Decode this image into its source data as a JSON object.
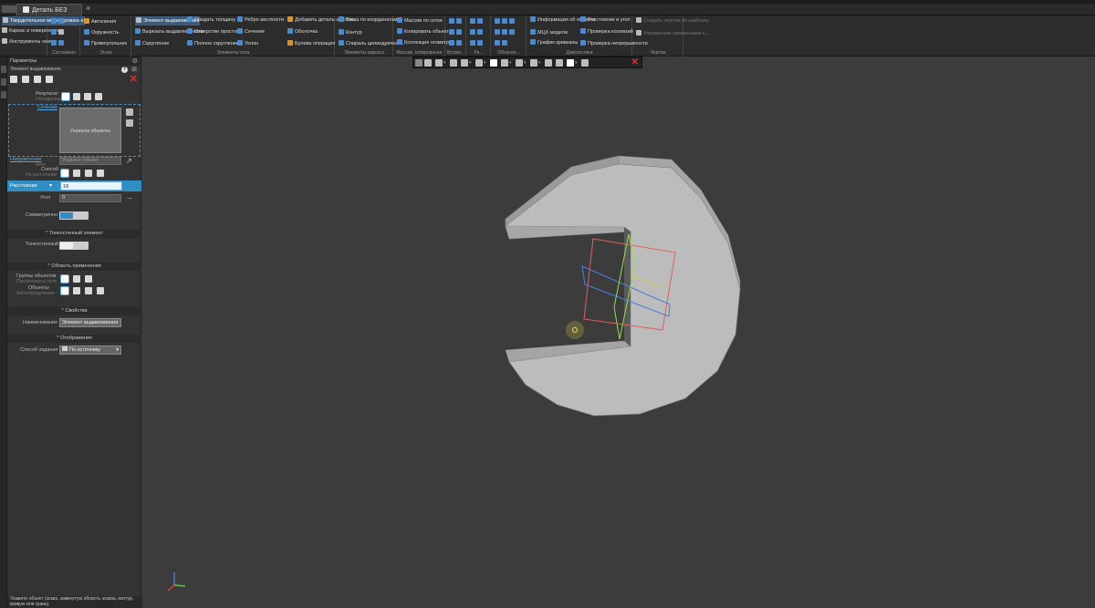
{
  "tabs": {
    "doc_title": "Деталь БЕЗ ИМЕНИ2"
  },
  "ribbon": {
    "mode_labels": [
      "Твердотельное моделирование",
      "Каркас и поверхности",
      "Инструменты эскиза"
    ],
    "groups": [
      {
        "name": "Системная"
      },
      {
        "name": "Эскиз",
        "items": [
          "Автолиния",
          "Окружность",
          "Прямоугольник"
        ]
      },
      {
        "name": "Элементы тела",
        "items": [
          "Элемент выдавливания",
          "Вырезать выдавливанием",
          "Скругление",
          "Придать толщину",
          "Отверстие простое",
          "Полное скругление",
          "Ребро жесткости",
          "Сечение",
          "Уклон",
          "Добавить деталь-заготов...",
          "Оболочка",
          "Булева операция"
        ]
      },
      {
        "name": "Элементы каркаса",
        "items": [
          "Точка по координатам",
          "Контур",
          "Спираль цилиндрическ..."
        ]
      },
      {
        "name": "Массив, копирование",
        "items": [
          "Массив по сетке",
          "Копировать объекты",
          "Коллекция геометрии"
        ]
      },
      {
        "name": "Вспом...",
        "items": []
      },
      {
        "name": "Ра...",
        "items": []
      },
      {
        "name": "Обознач...",
        "items": []
      },
      {
        "name": "Диагностика",
        "items": [
          "Информация об объекте",
          "МЦХ модели",
          "График кривизны",
          "Расстояние и угол",
          "Проверка коллизий",
          "Проверка непрерывности"
        ]
      },
      {
        "name": "Чертеж",
        "items": [
          "Создать чертеж по шаблону",
          "Управление связанными ч..."
        ]
      }
    ]
  },
  "panel": {
    "title": "Параметры",
    "subtitle": "Элемент выдавливания",
    "result_label": "Результат",
    "result_sub": "Объединение",
    "sketch_link": "Сечение",
    "objects_placeholder": "Укажите объекты",
    "direction_link": "Направление",
    "direction_sub": "Авто",
    "direction_placeholder": "Укажите объект",
    "method_label": "Способ",
    "method_sub": "На расстояние",
    "distance_label": "Расстояние",
    "distance_value": "18",
    "pitch_label": "Угол",
    "pitch_value": "0",
    "symmetric_label": "Симметрично",
    "thin_section": "Тонкостенный элемент",
    "thin_label": "Тонкостенный элемент",
    "scope_section": "Область применения",
    "scope_groups_label": "Группы объектов",
    "scope_groups_sub": "Построение в тела",
    "scope_objects_label": "Объекты",
    "scope_objects_sub": "Автоопределение",
    "props_section": "Свойства",
    "name_label": "Наименование",
    "name_value": "Элемент выдавливания",
    "display_section": "Отображение",
    "display_label": "Способ задания",
    "display_value": "По источнику"
  },
  "status": {
    "text": "Укажите объект (эскиз, замкнутую область эскиза, контур, кривую или грань)."
  },
  "colors": {
    "accent": "#2f8fc4",
    "model_fill": "#bcbcbc",
    "plane_red": "#e06060",
    "plane_blue": "#4a7fd6",
    "plane_green": "#8fe04a"
  }
}
